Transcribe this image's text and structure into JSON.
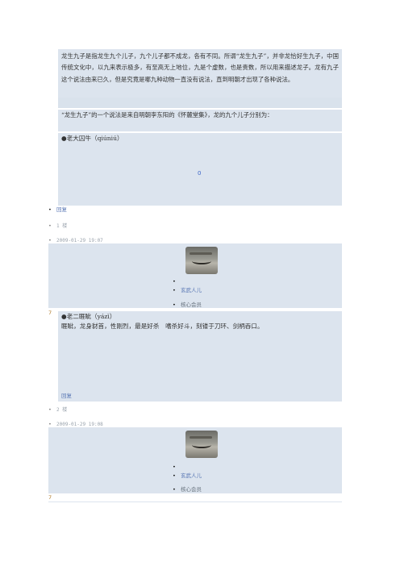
{
  "intro": {
    "text": "龙生九子是指龙生九个儿子，九个儿子都不成龙，各有不同。所谓“龙生九子”，并非龙恰好生九子，中国传统文化中，以九来表示极多，有至高无上地位，九是个虚数，也是贵数，所以用来描述龙子。龙有九子这个说法由来已久，但是究竟是哪九种动物一直没有说法，直到明朝才出现了各种说法。"
  },
  "source": {
    "text": "“龙生九子”的一个说法是来自明朝李东阳的《怀麓堂集》，龙的九个儿子分别为："
  },
  "son1": {
    "title": "●老大囚牛（qiúniú）",
    "counter": "0"
  },
  "post1": {
    "reply": "回复",
    "floor": "1 楼",
    "date": "2009-01-29 19:07",
    "user": "玄武人儿",
    "role": "核心会员",
    "level": "7"
  },
  "son2": {
    "title": "●老二睚眦（yázì）",
    "desc": "睚眦，龙身豺首，性刚烈，最是好杀　嗜杀好斗，刻镂于刀环、剑柄吞口。",
    "reply": "回复"
  },
  "post2": {
    "floor": "2 楼",
    "date": "2009-01-29 19:08",
    "user": "玄武人儿",
    "role": "核心会员",
    "level": "7"
  },
  "colors": {
    "panel": "#dce4ee",
    "link": "#5876b4",
    "accent": "#3d66c8"
  }
}
